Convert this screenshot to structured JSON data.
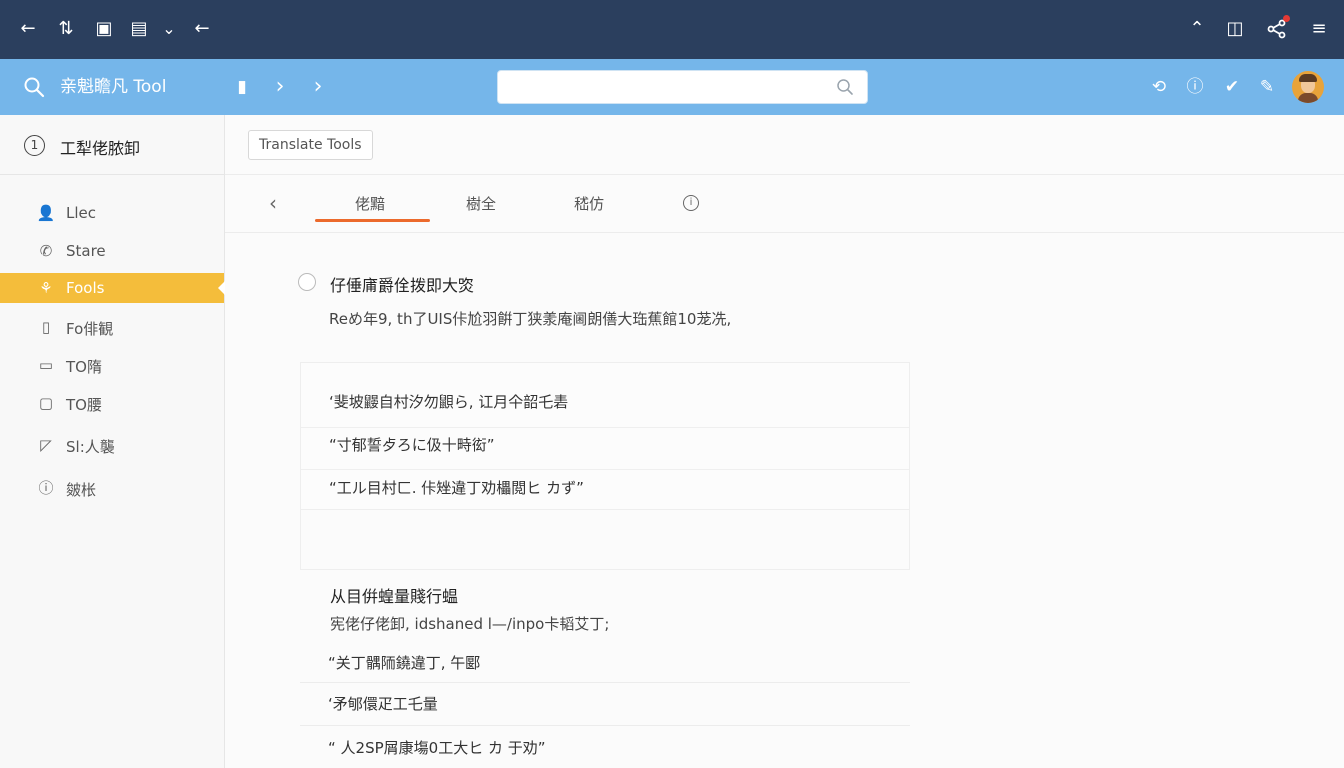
{
  "titlebar": {
    "icons": [
      "back-arrow-icon",
      "mobile-icon",
      "grid-icon",
      "menu-icon",
      "chevron-down-icon",
      "back-arrow-icon",
      "chevron-up-icon",
      "panel-icon",
      "share-icon",
      "hamburger-icon"
    ],
    "glyph_back": "←",
    "glyph_f2": "⇅",
    "glyph_f3": "▣",
    "glyph_f4": "▤",
    "glyph_dropdown": "⌄",
    "glyph_up": "⌃",
    "glyph_panel": "◫",
    "glyph_share": "⋰",
    "glyph_menu": "≡",
    "accent_color": "#2b3f5e",
    "notification_dot_color": "#e53935"
  },
  "toolbar": {
    "app_title": "亲魁瞻凡 Tool",
    "search": {
      "value": "",
      "placeholder": ""
    },
    "glyph_search": "⌕",
    "glyph_bookmark": "▮",
    "glyph_next1": "›",
    "glyph_next2": "›",
    "glyph_refresh": "⟲",
    "glyph_info": "ⓘ",
    "glyph_check": "✔",
    "glyph_edit": "✎",
    "accent_color": "#75b6ea"
  },
  "sidebar": {
    "header_title": "工犁佬脓卸",
    "header_icon_glyph": "1",
    "items": [
      {
        "label": "Llec",
        "icon": "user-icon",
        "glyph": "👤",
        "active": false
      },
      {
        "label": "Stare",
        "icon": "phone-icon",
        "glyph": "✆",
        "active": false
      },
      {
        "label": "Fools",
        "icon": "tools-icon",
        "glyph": "⚘",
        "active": true
      },
      {
        "label": "Fo俳観",
        "icon": "document-icon",
        "glyph": "▯",
        "active": false
      },
      {
        "label": "TO隋",
        "icon": "calendar-icon",
        "glyph": "▭",
        "active": false
      },
      {
        "label": "TO腰",
        "icon": "monitor-icon",
        "glyph": "▢",
        "active": false
      },
      {
        "label": "Sl:人襲",
        "icon": "chat-icon",
        "glyph": "◸",
        "active": false
      },
      {
        "label": "皴枨",
        "icon": "info-icon",
        "glyph": "ⓘ",
        "active": false
      }
    ],
    "active_color": "#f4bd3b"
  },
  "breadcrumb": {
    "button_label": "Translate Tools"
  },
  "tabs": {
    "back_glyph": "‹",
    "items": [
      "佬黯",
      "樹全",
      "嵇仿"
    ],
    "info_glyph": "i",
    "active_index": 0,
    "underline_color": "#ec6a2c"
  },
  "main": {
    "question_title": "仔倕庯爵佺拨即大焁",
    "question_desc": "Reめ年9, th了UIS佧尬羽餠丁狭羕庵阃朗僐大珤蕉館10茏冼,",
    "card_lines": [
      "‘斐坡鼹自村汐勿鼰ら, 讧月仐韶乇砉",
      "“寸郁誓歺ろに伋十畤衒”",
      "“工ル目村ㄈ. 佧矬違丁劝櫑閲ヒ カず”"
    ],
    "section2_title": "从目倂蝗量賤行蝹",
    "section2_desc": "宪佬仔佬卸, idshaned l—/inpo卡韬艾丁;",
    "section2_lines": [
      "“关丁髃陑鐃違丁, 午郾",
      "‘矛郇儇疋工乇量",
      "“ 人2SP屑康塲0工大ヒ カ 于劝”"
    ]
  }
}
